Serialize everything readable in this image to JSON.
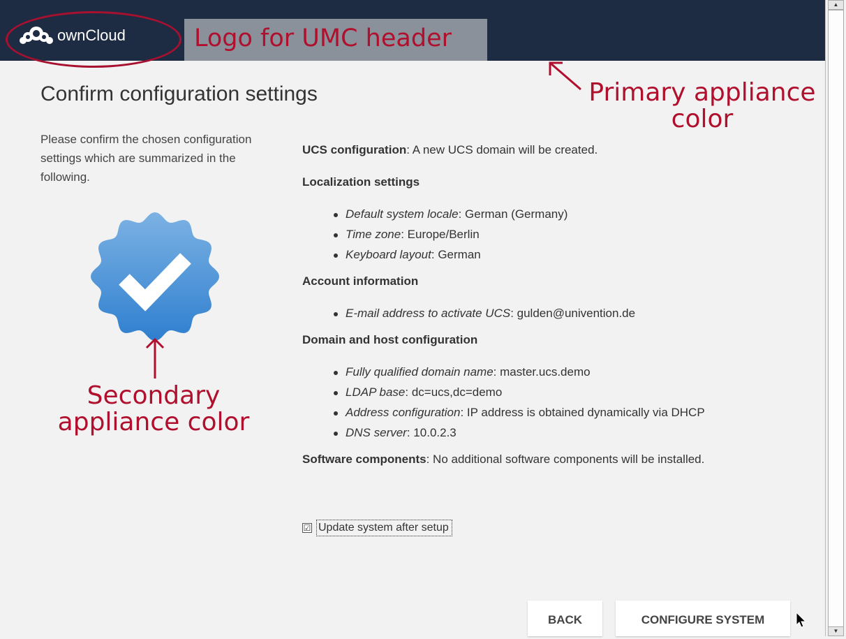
{
  "header": {
    "logo_text": "ownCloud",
    "primary_color": "#1e2c43"
  },
  "annotations": {
    "logo_label": "Logo for UMC header",
    "primary_line1": "Primary appliance",
    "primary_line2": "color",
    "secondary_line1": "Secondary",
    "secondary_line2": "appliance color",
    "annotation_color": "#b0102d"
  },
  "page": {
    "title": "Confirm configuration settings",
    "intro": "Please confirm the chosen configuration settings which are summarized in the following.",
    "badge_icon": "check-badge-icon",
    "secondary_color": "#4a8fd6"
  },
  "summary": {
    "ucs_label": "UCS configuration",
    "ucs_value": ": A new UCS domain will be created.",
    "localization_heading": "Localization settings",
    "localization_items": [
      {
        "key": "Default system locale",
        "value": ": German (Germany)"
      },
      {
        "key": "Time zone",
        "value": ": Europe/Berlin"
      },
      {
        "key": "Keyboard layout",
        "value": ": German"
      }
    ],
    "account_heading": "Account information",
    "account_items": [
      {
        "key": "E-mail address to activate UCS",
        "value": ": gulden@univention.de"
      }
    ],
    "domain_heading": "Domain and host configuration",
    "domain_items": [
      {
        "key": "Fully qualified domain name",
        "value": ": master.ucs.demo"
      },
      {
        "key": "LDAP base",
        "value": ": dc=ucs,dc=demo"
      },
      {
        "key": "Address configuration",
        "value": ": IP address is obtained dynamically via DHCP"
      },
      {
        "key": "DNS server",
        "value": ": 10.0.2.3"
      }
    ],
    "software_label": "Software components",
    "software_value": ": No additional software components will be installed."
  },
  "options": {
    "update_label": "Update system after setup",
    "update_checked": true,
    "check_glyph": "☑"
  },
  "buttons": {
    "back": "BACK",
    "configure": "CONFIGURE SYSTEM"
  }
}
